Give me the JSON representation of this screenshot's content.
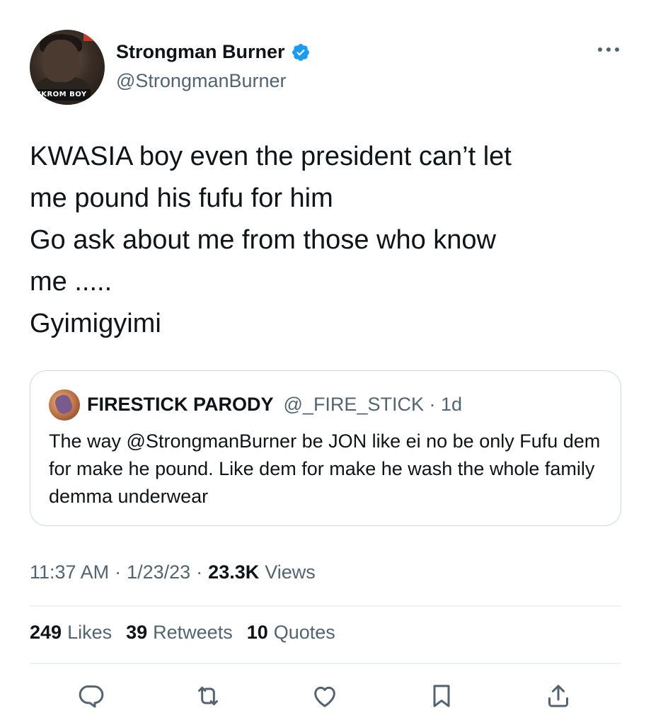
{
  "tweet": {
    "author": {
      "display_name": "Strongman Burner",
      "handle": "@StrongmanBurner",
      "verified": true,
      "avatar_caption": "NKROM BOY"
    },
    "text": "KWASIA boy even the president can’t let\nme pound his fufu for him\nGo ask about me from those who know\nme .....\nGyimigyimi",
    "quoted": {
      "display_name": "FIRESTICK PARODY",
      "handle_time": "@_FIRE_STICK · 1d",
      "text": "The way @StrongmanBurner be JON like ei no be only Fufu dem for make he pound. Like dem for make he wash the whole family demma underwear"
    },
    "meta": {
      "time": "11:37 AM",
      "date": "1/23/23",
      "views_count": "23.3K",
      "views_label": "Views"
    },
    "stats": [
      {
        "count": "249",
        "label": "Likes"
      },
      {
        "count": "39",
        "label": "Retweets"
      },
      {
        "count": "10",
        "label": "Quotes"
      }
    ],
    "actions": [
      "reply-icon",
      "retweet-icon",
      "like-icon",
      "bookmark-icon",
      "share-icon"
    ]
  },
  "colors": {
    "text_primary": "#0f1419",
    "text_secondary": "#536471",
    "verified_blue": "#1d9bf0",
    "border": "#cfd9de"
  }
}
